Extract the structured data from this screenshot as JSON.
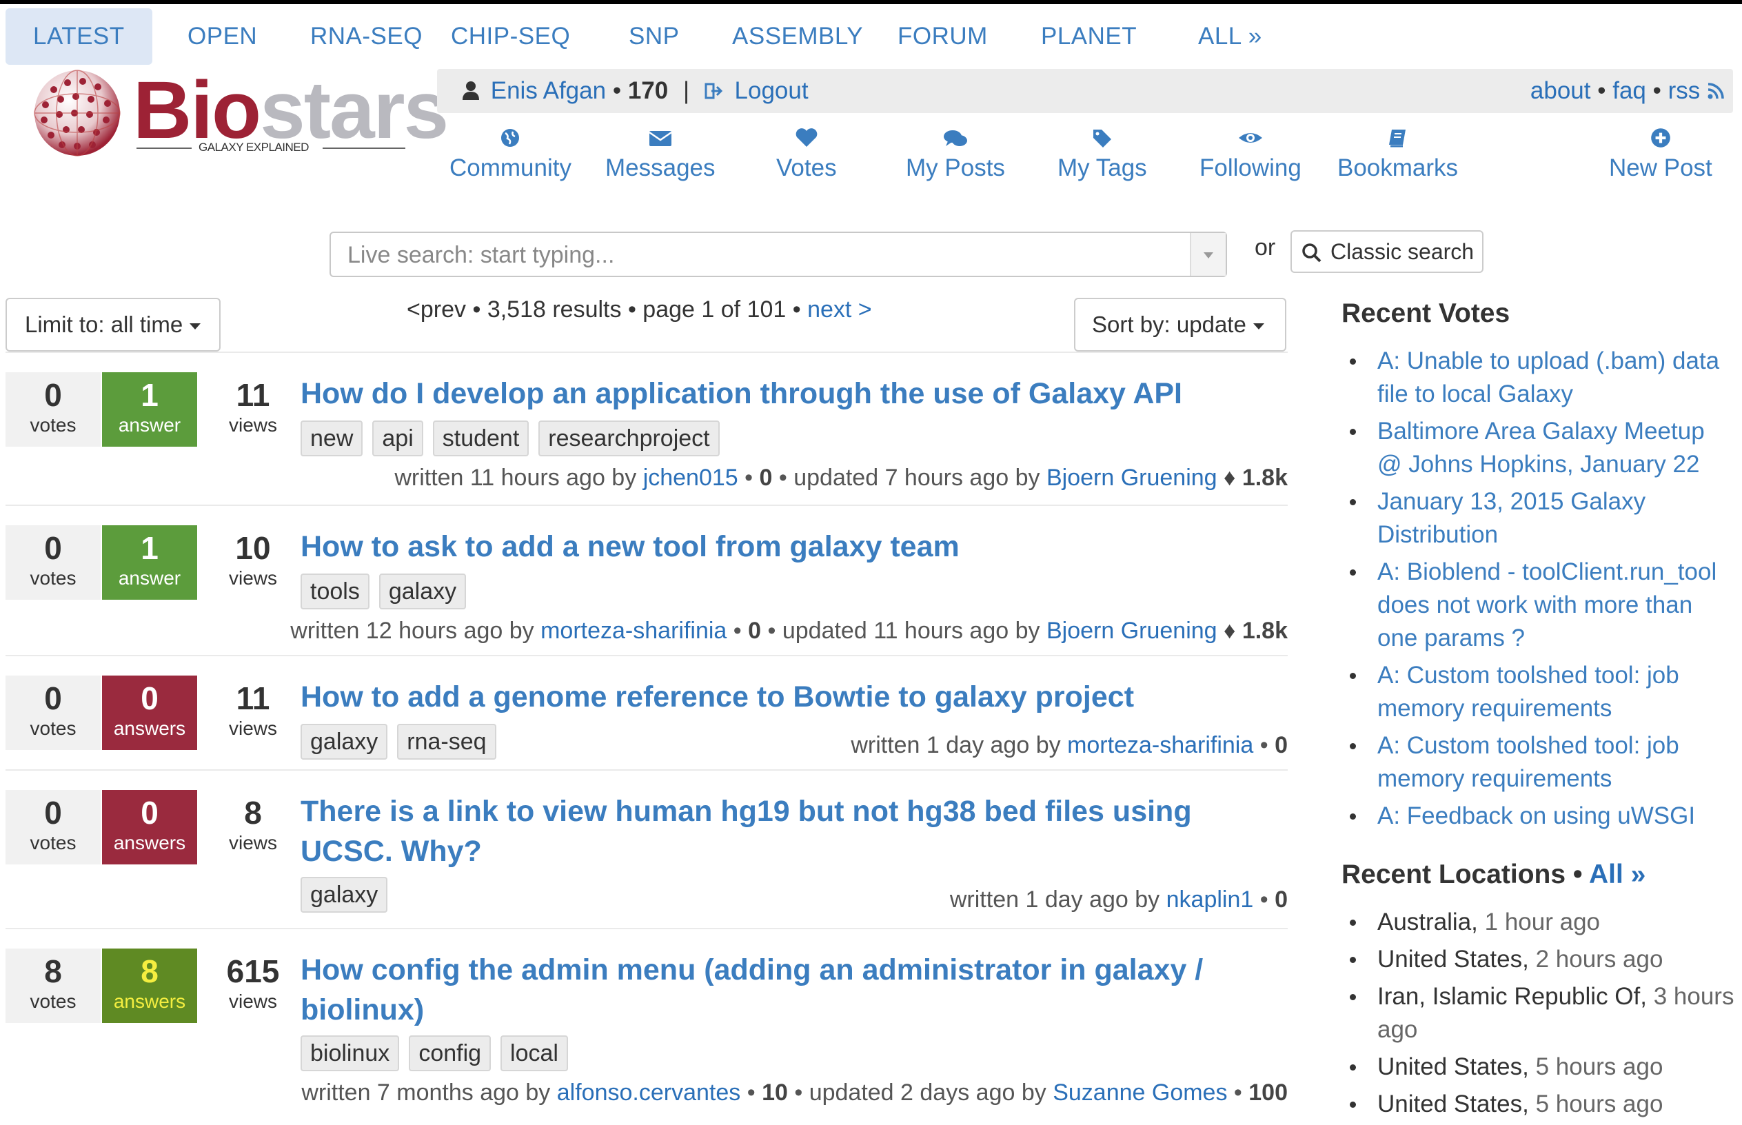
{
  "topnav": [
    "LATEST",
    "OPEN",
    "RNA-SEQ",
    "CHIP-SEQ",
    "SNP",
    "ASSEMBLY",
    "FORUM",
    "PLANET",
    "ALL »"
  ],
  "logo": {
    "bio": "Bio",
    "stars": "stars",
    "tagline": "GALAXY EXPLAINED"
  },
  "user": {
    "name": "Enis Afgan",
    "separator": "•",
    "rep": "170",
    "divider": "|",
    "logout": "Logout"
  },
  "links": {
    "about": "about",
    "faq": "faq",
    "rss": "rss",
    "dot": "•"
  },
  "iconnav": [
    "Community",
    "Messages",
    "Votes",
    "My Posts",
    "My Tags",
    "Following",
    "Bookmarks",
    "New Post"
  ],
  "search": {
    "placeholder": "Live search: start typing...",
    "or": "or",
    "classic": "Classic search"
  },
  "limit": "Limit to: all time",
  "sort": "Sort by: update",
  "pager": {
    "prev": "<prev",
    "results": "3,518 results",
    "page": "page 1 of 101",
    "next": "next >",
    "dot": "•"
  },
  "posts": [
    {
      "votes": "0",
      "votes_label": "votes",
      "answers": "1",
      "answers_label": "answer",
      "views": "11",
      "views_label": "views",
      "title": "How do I develop an application through the use of Galaxy API",
      "tags": [
        "new",
        "api",
        "student",
        "researchproject"
      ],
      "written": "written 11 hours ago by",
      "author": "jchen015",
      "author_rep": "0",
      "updated": "updated 7 hours ago by",
      "updater": "Bjoern Gruening",
      "updater_rep": "♦ 1.8k"
    },
    {
      "votes": "0",
      "votes_label": "votes",
      "answers": "1",
      "answers_label": "answer",
      "views": "10",
      "views_label": "views",
      "title": "How to ask to add a new tool from galaxy team",
      "tags": [
        "tools",
        "galaxy"
      ],
      "written": "written 12 hours ago by",
      "author": "morteza-sharifinia",
      "author_rep": "0",
      "updated": "updated 11 hours ago by",
      "updater": "Bjoern Gruening",
      "updater_rep": "♦ 1.8k"
    },
    {
      "votes": "0",
      "votes_label": "votes",
      "answers": "0",
      "answers_label": "answers",
      "views": "11",
      "views_label": "views",
      "title": "How to add a genome reference to Bowtie to galaxy project",
      "tags": [
        "galaxy",
        "rna-seq"
      ],
      "written": "written 1 day ago by",
      "author": "morteza-sharifinia",
      "author_rep": "0"
    },
    {
      "votes": "0",
      "votes_label": "votes",
      "answers": "0",
      "answers_label": "answers",
      "views": "8",
      "views_label": "views",
      "title": "There is a link to view human hg19 but not hg38 bed files using UCSC. Why?",
      "tags": [
        "galaxy"
      ],
      "written": "written 1 day ago by",
      "author": "nkaplin1",
      "author_rep": "0"
    },
    {
      "votes": "8",
      "votes_label": "votes",
      "answers": "8",
      "answers_label": "answers",
      "views": "615",
      "views_label": "views",
      "title": "How config the admin menu (adding an administrator in galaxy / biolinux)",
      "tags": [
        "biolinux",
        "config",
        "local"
      ],
      "written": "written 7 months ago by",
      "author": "alfonso.cervantes",
      "author_rep": "10",
      "updated": "updated 2 days ago by",
      "updater": "Suzanne Gomes",
      "updater_rep": "100"
    }
  ],
  "sidebar": {
    "recent_votes_title": "Recent Votes",
    "recent_votes": [
      "A: Unable to upload (.bam) data file to local Galaxy",
      "Baltimore Area Galaxy Meetup @ Johns Hopkins, January 22",
      "January 13, 2015 Galaxy Distribution",
      "A: Bioblend - toolClient.run_tool does not work with more than one params ?",
      "A: Custom toolshed tool: job memory requirements",
      "A: Custom toolshed tool: job memory requirements",
      "A: Feedback on using uWSGI"
    ],
    "recent_locations_title": "Recent Locations",
    "recent_locations_sep": "•",
    "recent_locations_all": "All »",
    "recent_locations": [
      {
        "place": "Australia,",
        "time": "1 hour ago"
      },
      {
        "place": "United States,",
        "time": "2 hours ago"
      },
      {
        "place": "Iran, Islamic Republic Of,",
        "time": "3 hours ago"
      },
      {
        "place": "United States,",
        "time": "5 hours ago"
      },
      {
        "place": "United States,",
        "time": "5 hours ago"
      }
    ]
  },
  "colors": {
    "link": "#3b7dbf",
    "brand": "#9d2235",
    "answered": "#5c9c3c",
    "unanswered": "#9a2a3e",
    "accepted_text": "#f4ee40"
  }
}
